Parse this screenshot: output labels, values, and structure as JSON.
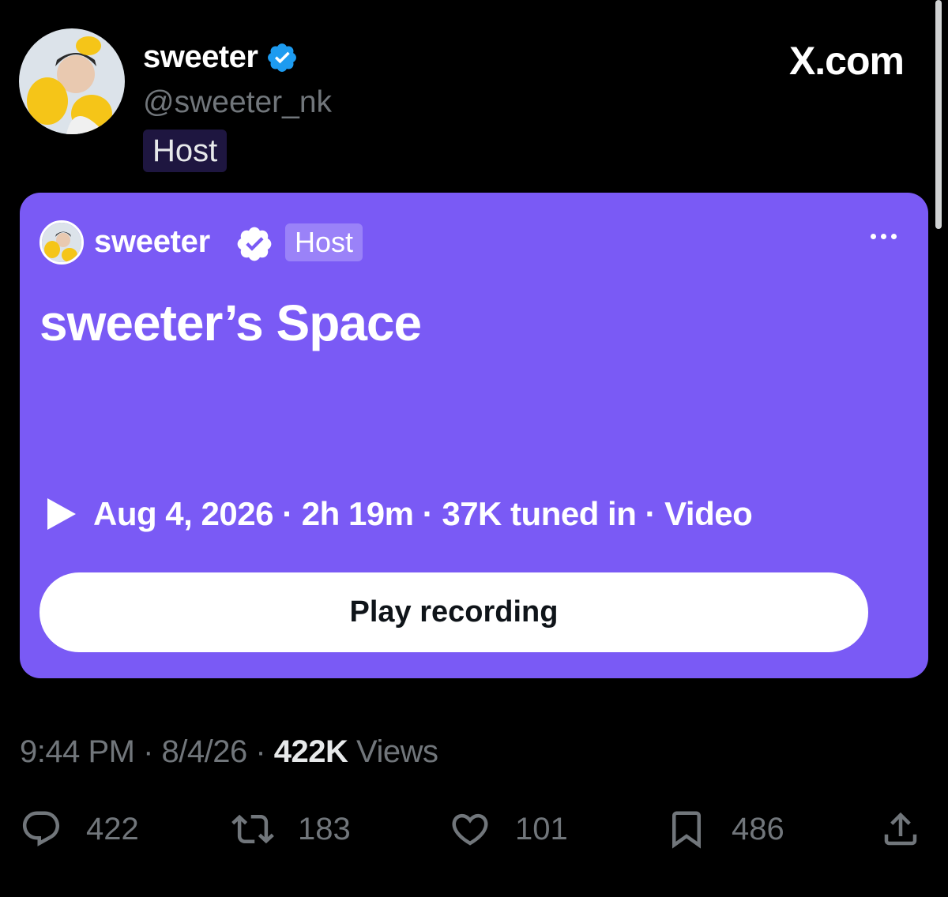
{
  "header": {
    "author_name": "sweeter",
    "handle": "@sweeter_nk",
    "host_badge": "Host",
    "site_label": "X.com"
  },
  "space": {
    "host_name": "sweeter",
    "host_badge": "Host",
    "title": "sweeter’s Space",
    "meta": "Aug 4, 2026 · 2h 19m · 37K tuned in · Video",
    "play_button_label": "Play recording",
    "card_color": "#7a5af5"
  },
  "timestamp": {
    "time_date": "9:44 PM · 8/4/26 · ",
    "views_count": "422K",
    "views_label": " Views"
  },
  "actions": {
    "replies": "422",
    "reposts": "183",
    "likes": "101",
    "bookmarks": "486"
  },
  "icons": [
    "verified-badge-icon",
    "more-icon",
    "play-icon",
    "reply-icon",
    "repost-icon",
    "like-icon",
    "bookmark-icon",
    "share-icon"
  ],
  "colors": {
    "accent_blue": "#1d9bf0",
    "muted_text": "#71767b",
    "background": "#000000"
  }
}
